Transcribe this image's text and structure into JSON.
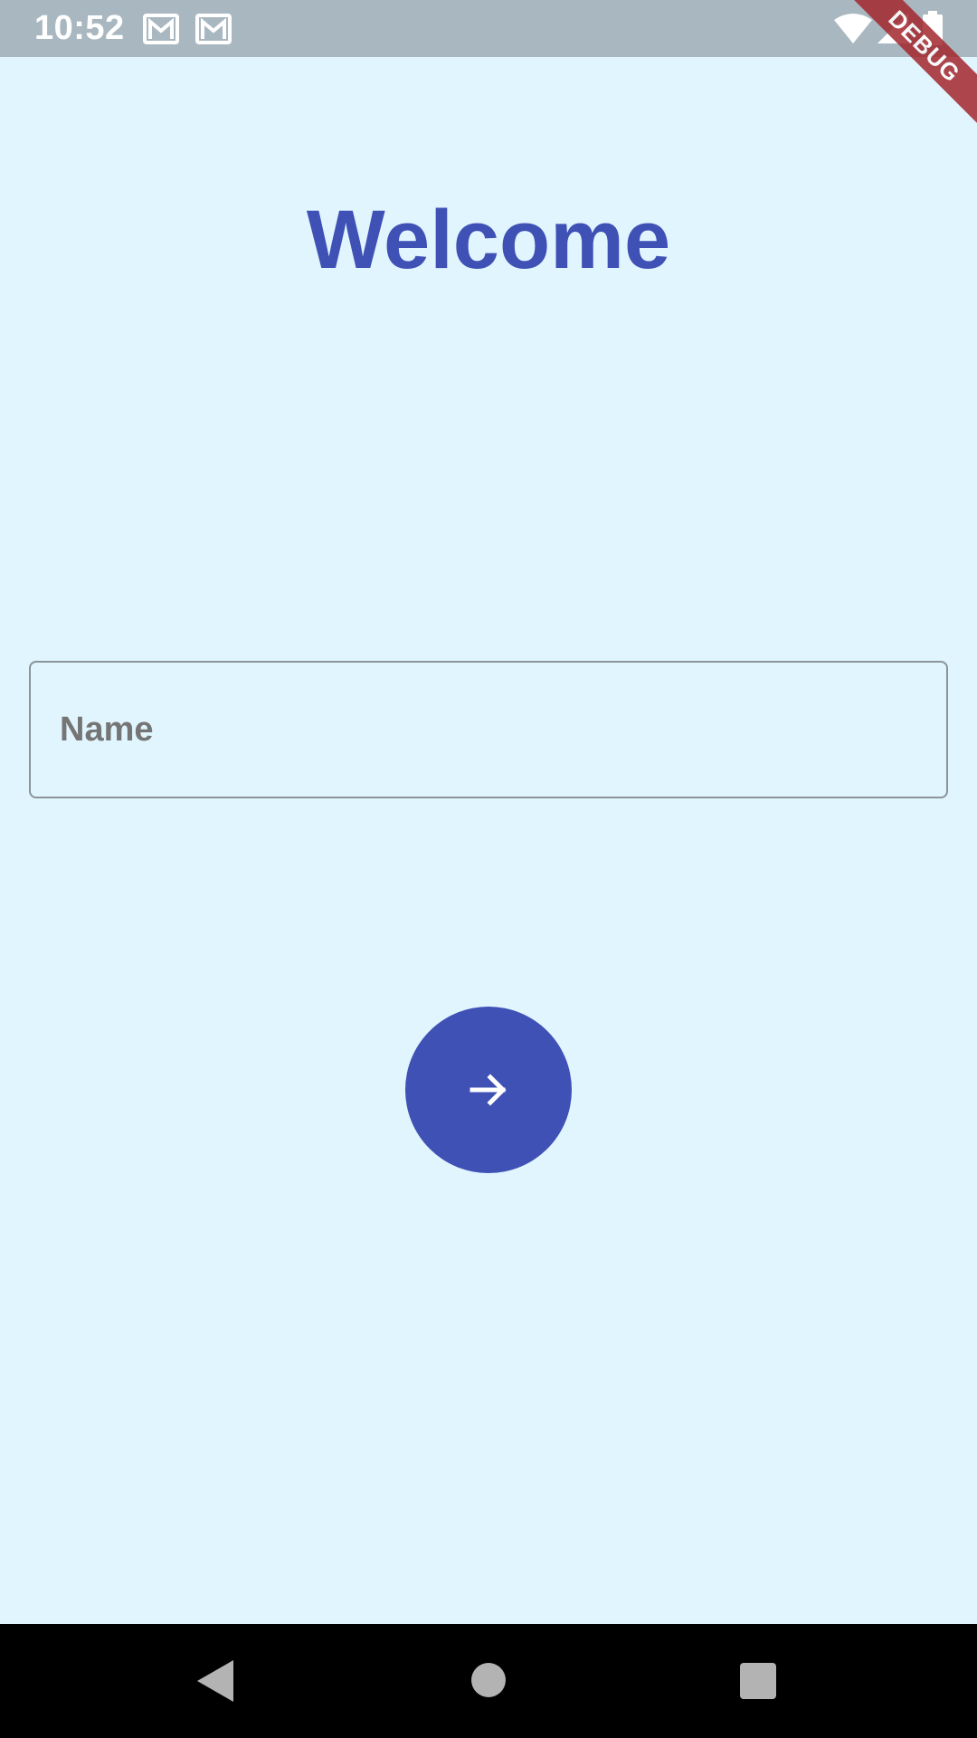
{
  "status_bar": {
    "time": "10:52",
    "notification_icons": [
      "gmail-icon",
      "gmail-icon"
    ],
    "system_icons": [
      "wifi-icon",
      "signal-icon",
      "battery-icon"
    ]
  },
  "debug_banner": {
    "label": "DEBUG"
  },
  "main": {
    "title": "Welcome",
    "name_field": {
      "placeholder": "Name",
      "value": ""
    },
    "next_button": {
      "icon": "arrow-forward-icon"
    }
  },
  "nav_bar": {
    "buttons": [
      "back-icon",
      "home-icon",
      "recents-icon"
    ]
  },
  "colors": {
    "background": "#E1F5FE",
    "primary": "#3F51B5",
    "status_bar": "#A9B8C0",
    "field_border": "#8A9499",
    "placeholder": "#757575",
    "nav_bar": "#000000",
    "debug_banner": "#A3282E"
  }
}
